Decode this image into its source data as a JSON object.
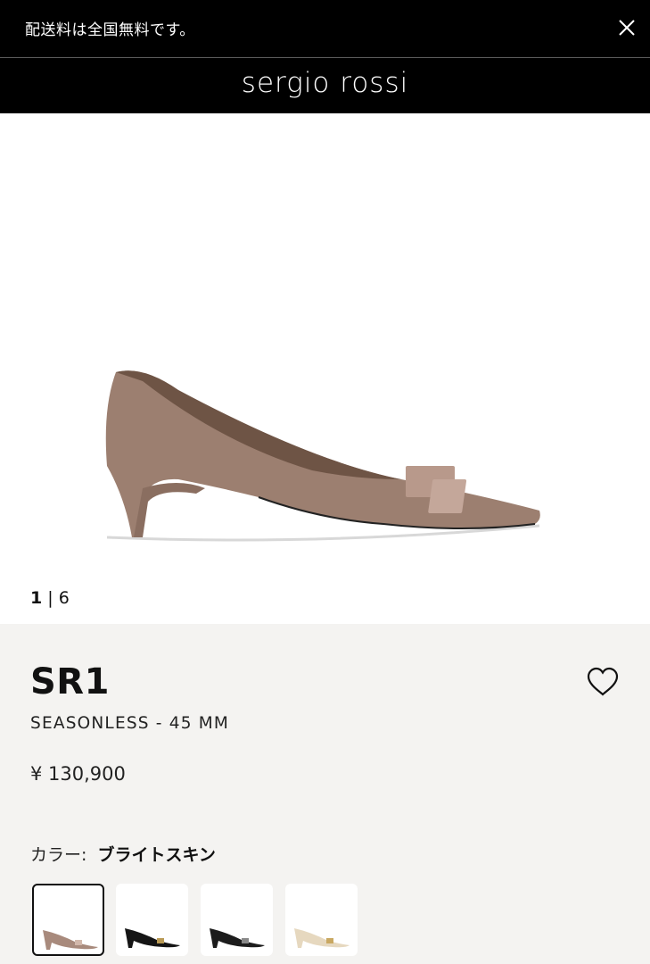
{
  "promo": {
    "text": "配送料は全国無料です。",
    "close_icon": "close-icon"
  },
  "header": {
    "logo": "sergio rossi"
  },
  "gallery": {
    "current": "1",
    "separator": "|",
    "total": "6"
  },
  "product": {
    "name": "SR1",
    "subtitle": "SEASONLESS - 45 MM",
    "price": "¥ 130,900",
    "wishlist_icon": "heart-icon",
    "color_label": "カラー:",
    "color_value": "ブライトスキン"
  },
  "swatches": [
    {
      "name": "bright-skin",
      "color": "#a88a7c",
      "selected": true
    },
    {
      "name": "black-1",
      "color": "#151515",
      "selected": false
    },
    {
      "name": "black-2",
      "color": "#1c1c1c",
      "selected": false
    },
    {
      "name": "cream",
      "color": "#e6d8bf",
      "selected": false
    }
  ],
  "colors": {
    "shoe_main": "#9c7f70",
    "buckle": "#c4a79a",
    "panel_bg": "#f4f3f1"
  }
}
